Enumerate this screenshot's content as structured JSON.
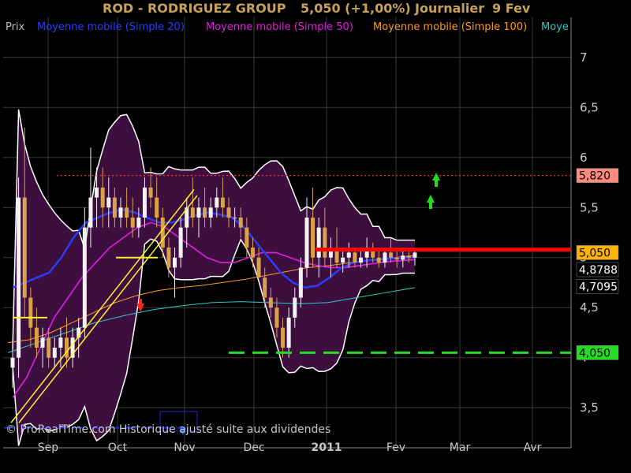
{
  "header": {
    "title": "ROD - RODRIGUEZ GROUP",
    "quote": "5,050 (+1,00%)",
    "period": "Journalier",
    "date": "9 Fev"
  },
  "legend": [
    {
      "label": "Prix",
      "color": "#bdbdbd"
    },
    {
      "label": "Moyenne mobile (Simple 20)",
      "color": "#2a3cff"
    },
    {
      "label": "Moyenne mobile (Simple 50)",
      "color": "#e11ee1"
    },
    {
      "label": "Moyenne mobile (Simple 100)",
      "color": "#ff9a1e"
    },
    {
      "label": "Moye",
      "color": "#2ec9c9"
    }
  ],
  "watermark": "© ProRealTime.com Historique ajusté suite aux dividendes",
  "colors": {
    "background": "#000000",
    "band_fill": "#3d0f3f",
    "band_edge": "#ffffff",
    "grid": "#3a3a3a",
    "axis_text": "#c8c8c8",
    "title": "#c8a25a",
    "sma20": "#2a3cff",
    "sma50": "#e11ee1",
    "sma100": "#ff9a1e",
    "sma200": "#2ec9c9",
    "candle_up": "#f2f2f2",
    "candle_down": "#d9a24a"
  },
  "chart_data": {
    "type": "candlestick",
    "ylim": [
      3.1,
      7.4
    ],
    "y_ticks": [
      3.5,
      4,
      4.5,
      5,
      5.5,
      6,
      6.5,
      7
    ],
    "y_tick_labels": [
      "3,5",
      "4",
      "4,5",
      "5",
      "5,5",
      "6",
      "6,5",
      "7"
    ],
    "x_labels": [
      "Sep",
      "Oct",
      "Nov",
      "Dec",
      "2011",
      "Fev",
      "Mar",
      "Avr"
    ],
    "price_labels": [
      {
        "text": "5,820",
        "value": 5.82,
        "bg": "#ff8a80",
        "fg": "#000000"
      },
      {
        "text": "5,050",
        "value": 5.05,
        "bg": "#ffb300",
        "fg": "#000000"
      },
      {
        "text": "4,8788",
        "value": 4.88,
        "bg": "#000000",
        "fg": "#ffffff"
      },
      {
        "text": "4,7095",
        "value": 4.71,
        "bg": "#000000",
        "fg": "#ffffff"
      },
      {
        "text": "4,050",
        "value": 4.05,
        "bg": "#22dd22",
        "fg": "#000000"
      }
    ],
    "levels": [
      {
        "value": 5.82,
        "style": "dotted",
        "color": "#ff2a2a"
      },
      {
        "value": 5.08,
        "style": "solid",
        "color": "#ff0000"
      },
      {
        "value": 4.05,
        "style": "dashed",
        "color": "#22dd22"
      },
      {
        "value": 3.3,
        "style": "dashed",
        "color": "#2222cc"
      }
    ],
    "candles": [
      [
        3.9,
        4.2,
        3.7,
        4.0
      ],
      [
        4.0,
        5.8,
        3.8,
        5.6
      ],
      [
        5.6,
        6.3,
        4.4,
        4.6
      ],
      [
        4.6,
        4.7,
        4.1,
        4.3
      ],
      [
        4.3,
        4.5,
        4.0,
        4.1
      ],
      [
        4.1,
        4.3,
        3.9,
        4.2
      ],
      [
        4.2,
        4.3,
        3.9,
        4.0
      ],
      [
        4.0,
        4.2,
        3.9,
        4.1
      ],
      [
        4.1,
        4.3,
        3.9,
        4.2
      ],
      [
        4.2,
        4.4,
        3.9,
        4.0
      ],
      [
        4.0,
        4.3,
        3.9,
        4.2
      ],
      [
        4.2,
        4.4,
        4.0,
        4.3
      ],
      [
        4.3,
        5.5,
        4.2,
        5.3
      ],
      [
        5.3,
        6.1,
        5.1,
        5.6
      ],
      [
        5.6,
        5.9,
        5.3,
        5.7
      ],
      [
        5.7,
        5.9,
        5.3,
        5.5
      ],
      [
        5.5,
        5.8,
        5.3,
        5.6
      ],
      [
        5.6,
        5.7,
        5.3,
        5.4
      ],
      [
        5.4,
        5.6,
        5.3,
        5.5
      ],
      [
        5.5,
        5.7,
        5.3,
        5.4
      ],
      [
        5.4,
        5.6,
        5.2,
        5.3
      ],
      [
        5.3,
        5.5,
        5.2,
        5.4
      ],
      [
        5.4,
        5.8,
        5.3,
        5.7
      ],
      [
        5.7,
        5.9,
        5.5,
        5.6
      ],
      [
        5.6,
        5.8,
        5.3,
        5.4
      ],
      [
        5.4,
        5.5,
        5.0,
        5.1
      ],
      [
        5.1,
        5.2,
        4.8,
        4.9
      ],
      [
        4.9,
        5.1,
        4.6,
        5.0
      ],
      [
        5.0,
        5.4,
        4.9,
        5.3
      ],
      [
        5.3,
        5.6,
        5.1,
        5.5
      ],
      [
        5.5,
        5.8,
        5.3,
        5.4
      ],
      [
        5.4,
        5.6,
        5.2,
        5.5
      ],
      [
        5.5,
        5.7,
        5.3,
        5.4
      ],
      [
        5.4,
        5.6,
        5.3,
        5.5
      ],
      [
        5.5,
        5.7,
        5.4,
        5.6
      ],
      [
        5.6,
        5.8,
        5.4,
        5.5
      ],
      [
        5.5,
        5.6,
        5.3,
        5.4
      ],
      [
        5.4,
        5.5,
        5.3,
        5.4
      ],
      [
        5.4,
        5.5,
        5.2,
        5.3
      ],
      [
        5.3,
        5.4,
        5.0,
        5.1
      ],
      [
        5.1,
        5.2,
        4.9,
        5.0
      ],
      [
        5.0,
        5.1,
        4.8,
        4.8
      ],
      [
        4.8,
        4.9,
        4.5,
        4.6
      ],
      [
        4.6,
        4.7,
        4.4,
        4.5
      ],
      [
        4.5,
        4.6,
        4.2,
        4.3
      ],
      [
        4.3,
        4.4,
        4.0,
        4.1
      ],
      [
        4.1,
        4.5,
        4.0,
        4.4
      ],
      [
        4.4,
        4.7,
        4.3,
        4.6
      ],
      [
        4.6,
        5.0,
        4.5,
        4.9
      ],
      [
        4.9,
        5.6,
        4.8,
        5.4
      ],
      [
        5.4,
        5.7,
        4.9,
        5.0
      ],
      [
        5.0,
        5.4,
        4.8,
        5.3
      ],
      [
        5.3,
        5.5,
        4.9,
        5.0
      ],
      [
        5.0,
        5.2,
        4.8,
        5.1
      ],
      [
        5.1,
        5.3,
        4.9,
        4.95
      ],
      [
        4.95,
        5.1,
        4.85,
        5.0
      ],
      [
        5.0,
        5.15,
        4.9,
        5.05
      ],
      [
        5.05,
        5.1,
        4.9,
        4.95
      ],
      [
        4.95,
        5.1,
        4.9,
        5.0
      ],
      [
        5.0,
        5.2,
        4.9,
        5.1
      ],
      [
        5.1,
        5.15,
        4.95,
        5.0
      ],
      [
        5.0,
        5.1,
        4.9,
        4.95
      ],
      [
        4.95,
        5.1,
        4.9,
        5.05
      ],
      [
        5.05,
        5.2,
        4.95,
        5.0
      ],
      [
        5.0,
        5.1,
        4.9,
        4.98
      ],
      [
        4.98,
        5.08,
        4.9,
        5.02
      ],
      [
        5.02,
        5.1,
        4.95,
        5.0
      ],
      [
        5.0,
        5.08,
        4.92,
        5.05
      ]
    ],
    "sma20": [
      4.7,
      4.75,
      4.8,
      4.85,
      5.0,
      5.2,
      5.35,
      5.4,
      5.45,
      5.48,
      5.45,
      5.4,
      5.35,
      5.35,
      5.38,
      5.42,
      5.45,
      5.43,
      5.4,
      5.3,
      5.15,
      5.0,
      4.85,
      4.75,
      4.7,
      4.72,
      4.8,
      4.9,
      4.95,
      4.97,
      4.98,
      4.99,
      5.0,
      5.0
    ],
    "sma50": [
      3.6,
      3.8,
      4.1,
      4.4,
      4.6,
      4.8,
      4.95,
      5.1,
      5.2,
      5.3,
      5.35,
      5.3,
      5.2,
      5.1,
      5.0,
      4.95,
      4.95,
      5.0,
      5.05,
      5.05,
      5.0,
      4.95,
      4.92,
      4.9,
      4.9,
      4.92,
      4.94,
      4.96,
      4.97,
      4.98
    ],
    "sma100": [
      4.15,
      4.18,
      4.25,
      4.35,
      4.45,
      4.55,
      4.62,
      4.67,
      4.7,
      4.72,
      4.75,
      4.78,
      4.82,
      4.86,
      4.9,
      4.92,
      4.95,
      4.98,
      5.0,
      5.02
    ],
    "sma200": [
      4.05,
      4.15,
      4.25,
      4.35,
      4.42,
      4.48,
      4.52,
      4.55,
      4.56,
      4.55,
      4.54,
      4.55,
      4.6,
      4.65,
      4.7
    ]
  }
}
